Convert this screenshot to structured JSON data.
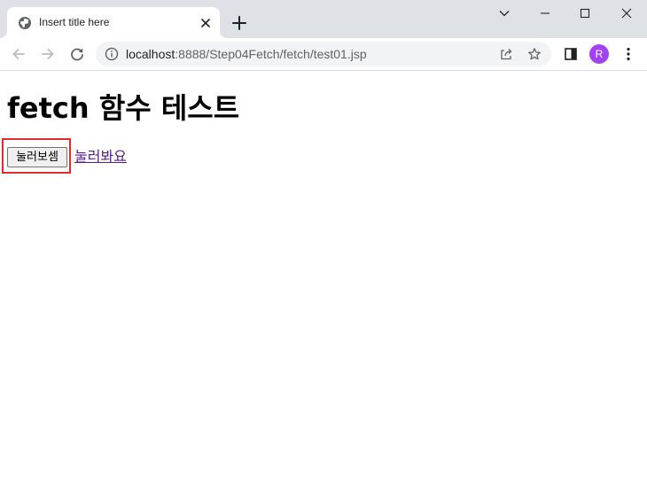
{
  "browser": {
    "tab": {
      "title": "Insert title here"
    },
    "address_bar": {
      "host": "localhost",
      "path": ":8888/Step04Fetch/fetch/test01.jsp"
    },
    "profile_initial": "R",
    "icons": {
      "favicon": "globe-icon",
      "tab_close": "close-icon",
      "new_tab": "plus-icon",
      "back": "back-arrow-icon",
      "forward": "forward-arrow-icon",
      "reload": "reload-icon",
      "site_info": "info-icon",
      "share": "share-icon",
      "bookmark": "star-icon",
      "side_panel": "side-panel-icon",
      "menu": "more-vert-icon",
      "tab_search": "chevron-down-icon",
      "minimize": "minimize-icon",
      "maximize": "maximize-icon",
      "close_window": "close-icon"
    },
    "colors": {
      "frame": "#dee1e6",
      "avatar": "#a142f4",
      "highlight": "#e32b2b",
      "visited_link": "#551a8b"
    }
  },
  "page": {
    "heading": "fetch 함수 테스트",
    "button_label": "눌러보셈",
    "link_label": "눌러봐요"
  }
}
